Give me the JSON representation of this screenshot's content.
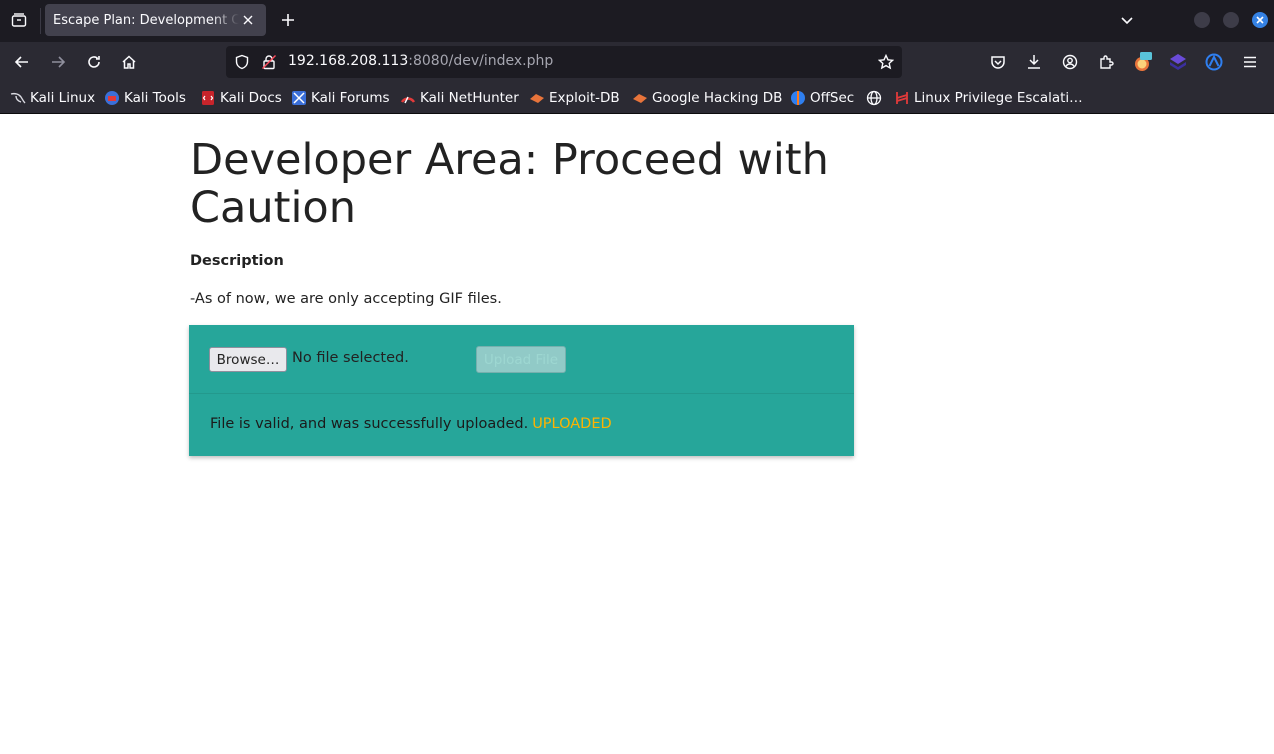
{
  "browser": {
    "tab_title": "Escape Plan: Development C",
    "url_host": "192.168.208.113",
    "url_rest": ":8080/dev/index.php",
    "accent_color": "#3582e4"
  },
  "bookmarks": [
    {
      "label": "Kali Linux",
      "icon": "kali-dragon-icon"
    },
    {
      "label": "Kali Tools",
      "icon": "kali-tools-icon"
    },
    {
      "label": "Kali Docs",
      "icon": "kali-docs-icon"
    },
    {
      "label": "Kali Forums",
      "icon": "kali-forums-icon"
    },
    {
      "label": "Kali NetHunter",
      "icon": "kali-nethunter-icon"
    },
    {
      "label": "Exploit-DB",
      "icon": "exploit-db-icon"
    },
    {
      "label": "Google Hacking DB",
      "icon": "ghdb-icon"
    },
    {
      "label": "OffSec",
      "icon": "offsec-icon"
    },
    {
      "label": "",
      "icon": "globe-icon"
    },
    {
      "label": "Linux Privilege Escalati…",
      "icon": "hacktricks-icon"
    }
  ],
  "page": {
    "heading": "Developer Area: Proceed with Caution",
    "description_label": "Description",
    "description_text": "-As of now, we are only accepting GIF files.",
    "browse_label": "Browse…",
    "file_status": "No file selected.",
    "upload_label": "Upload File",
    "result_text": "File is valid, and was successfully uploaded.",
    "result_badge": "UPLOADED",
    "card_color": "#26a69a",
    "badge_color": "#ffb300"
  }
}
